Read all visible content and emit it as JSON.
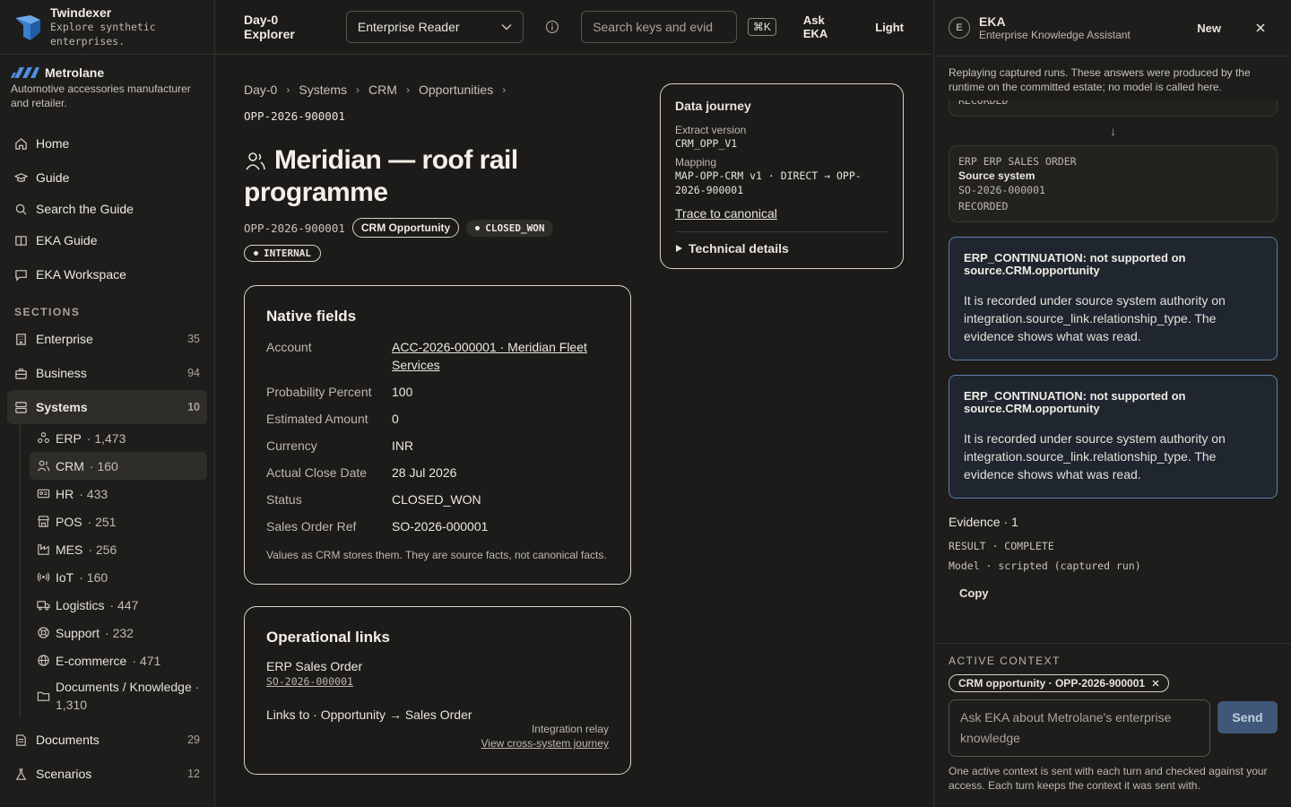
{
  "brand": {
    "name": "Twindexer",
    "tagline": "Explore synthetic enterprises."
  },
  "tenant": {
    "name": "Metrolane",
    "description": "Automotive accessories manufacturer and retailer."
  },
  "nav": [
    {
      "label": "Home",
      "icon": "home-icon"
    },
    {
      "label": "Guide",
      "icon": "graduation-cap-icon"
    },
    {
      "label": "Search the Guide",
      "icon": "search-icon"
    },
    {
      "label": "EKA Guide",
      "icon": "book-icon"
    },
    {
      "label": "EKA Workspace",
      "icon": "chat-icon"
    }
  ],
  "sections_label": "SECTIONS",
  "sections": [
    {
      "label": "Enterprise",
      "count": "35",
      "icon": "building-icon"
    },
    {
      "label": "Business",
      "count": "94",
      "icon": "briefcase-icon"
    },
    {
      "label": "Systems",
      "count": "10",
      "icon": "server-icon",
      "active": true
    }
  ],
  "systems": [
    {
      "label": "ERP",
      "count": " · 1,473",
      "icon": "network-icon"
    },
    {
      "label": "CRM",
      "count": " · 160",
      "icon": "users-icon",
      "active": true
    },
    {
      "label": "HR",
      "count": " · 433",
      "icon": "id-card-icon"
    },
    {
      "label": "POS",
      "count": " · 251",
      "icon": "store-icon"
    },
    {
      "label": "MES",
      "count": " · 256",
      "icon": "factory-icon"
    },
    {
      "label": "IoT",
      "count": " · 160",
      "icon": "radio-icon"
    },
    {
      "label": "Logistics",
      "count": " · 447",
      "icon": "truck-icon"
    },
    {
      "label": "Support",
      "count": " · 232",
      "icon": "lifebuoy-icon"
    },
    {
      "label": "E-commerce",
      "count": " · 471",
      "icon": "globe-icon"
    },
    {
      "label": "Documents / Knowledge",
      "count": " · 1,310",
      "icon": "folder-icon"
    }
  ],
  "sections_bottom": [
    {
      "label": "Documents",
      "count": "29",
      "icon": "document-icon"
    },
    {
      "label": "Scenarios",
      "count": "12",
      "icon": "flask-icon"
    }
  ],
  "topbar": {
    "title": "Day-0 Explorer",
    "lens": "Enterprise Reader",
    "search_placeholder": "Search keys and evid",
    "shortcut": "⌘K",
    "ask": "Ask EKA",
    "theme": "Light"
  },
  "breadcrumb": [
    "Day-0",
    "Systems",
    "CRM",
    "Opportunities"
  ],
  "record": {
    "id": "OPP-2026-900001",
    "title": "Meridian — roof rail programme",
    "type_badge": "CRM Opportunity",
    "status_badge": "CLOSED_WON",
    "visibility_badge": "INTERNAL"
  },
  "native_fields": {
    "title": "Native fields",
    "rows": [
      {
        "k": "Account",
        "v": "ACC-2026-000001 · Meridian Fleet Services",
        "link": true
      },
      {
        "k": "Probability Percent",
        "v": "100"
      },
      {
        "k": "Estimated Amount",
        "v": "0"
      },
      {
        "k": "Currency",
        "v": "INR"
      },
      {
        "k": "Actual Close Date",
        "v": "28 Jul 2026"
      },
      {
        "k": "Status",
        "v": "CLOSED_WON"
      },
      {
        "k": "Sales Order Ref",
        "v": "SO-2026-000001"
      }
    ],
    "note": "Values as CRM stores them. They are source facts, not canonical facts."
  },
  "operational_links": {
    "title": "Operational links",
    "item_label": "ERP Sales Order",
    "item_id": "SO-2026-000001",
    "links_to": "Links to · Opportunity → Sales Order",
    "relay": "Integration relay",
    "journey_link": "View cross-system journey"
  },
  "journey": {
    "title": "Data journey",
    "extract_label": "Extract version",
    "extract_value": "CRM_OPP_V1",
    "mapping_label": "Mapping",
    "mapping_value": "MAP-OPP-CRM v1 · DIRECT → OPP-2026-900001",
    "trace": "Trace to canonical",
    "technical": "Technical details"
  },
  "panel": {
    "avatar": "E",
    "title": "EKA",
    "subtitle": "Enterprise Knowledge Assistant",
    "new": "New",
    "notice": "Replaying captured runs. These answers were produced by the runtime on the committed estate; no model is called here.",
    "prev_step_status": "RECORDED",
    "step": {
      "head": "ERP ERP SALES ORDER",
      "label": "Source system",
      "id": "SO-2026-000001",
      "status": "RECORDED"
    },
    "errors": [
      {
        "title": "ERP_CONTINUATION: not supported on source.CRM.opportunity",
        "body": "It is recorded under source system authority on integration.source_link.relationship_type. The evidence shows what was read."
      },
      {
        "title": "ERP_CONTINUATION: not supported on source.CRM.opportunity",
        "body": "It is recorded under source system authority on integration.source_link.relationship_type. The evidence shows what was read."
      }
    ],
    "evidence": "Evidence · 1",
    "result": "RESULT · COMPLETE",
    "model": "Model · scripted (captured run)",
    "copy": "Copy",
    "context_label": "ACTIVE CONTEXT",
    "context_chip": "CRM opportunity · OPP-2026-900001",
    "ask_placeholder": "Ask EKA about Metrolane's enterprise knowledge",
    "send": "Send",
    "context_note": "One active context is sent with each turn and checked against your access. Each turn keeps the context it was sent with."
  },
  "colors": {
    "background": "#1c1b19",
    "panel": "#1e1d1b",
    "accent_blue": "#5b7ea8",
    "send_button": "#3f5778"
  }
}
